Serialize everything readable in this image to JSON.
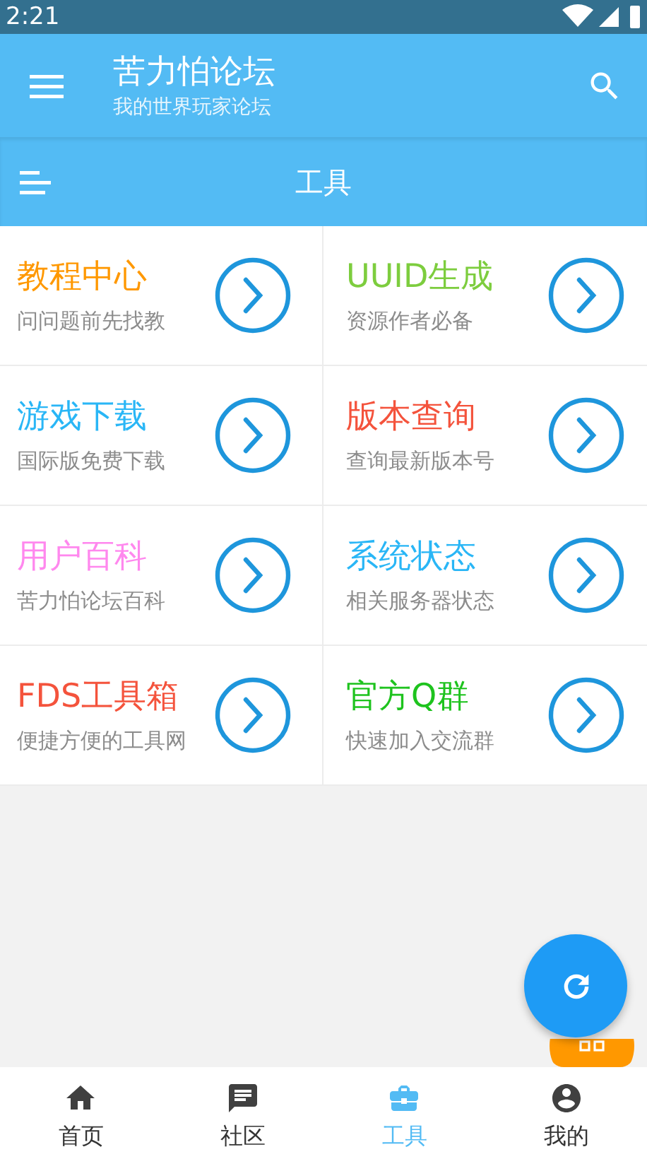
{
  "status_bar": {
    "time": "2:21"
  },
  "app_bar": {
    "title": "苦力怕论坛",
    "subtitle": "我的世界玩家论坛"
  },
  "toolbar": {
    "title": "工具"
  },
  "tools": [
    {
      "title": "教程中心",
      "subtitle": "问问题前先找教",
      "color": "#ff9800"
    },
    {
      "title": "UUID生成",
      "subtitle": "资源作者必备",
      "color": "#7dcd3e"
    },
    {
      "title": "游戏下载",
      "subtitle": "国际版免费下载",
      "color": "#29b6f6"
    },
    {
      "title": "版本查询",
      "subtitle": "查询最新版本号",
      "color": "#f4533c"
    },
    {
      "title": "用户百科",
      "subtitle": "苦力怕论坛百科",
      "color": "#ff88ee"
    },
    {
      "title": "系统状态",
      "subtitle": "相关服务器状态",
      "color": "#29b6f6"
    },
    {
      "title": "FDS工具箱",
      "subtitle": "便捷方便的工具网",
      "color": "#f4533c"
    },
    {
      "title": "官方Q群",
      "subtitle": "快速加入交流群",
      "color": "#1ec31e"
    }
  ],
  "bottom_nav": [
    {
      "label": "首页",
      "kind": "home",
      "selected": false
    },
    {
      "label": "社区",
      "kind": "chat",
      "selected": false
    },
    {
      "label": "工具",
      "kind": "toolbox",
      "selected": true
    },
    {
      "label": "我的",
      "kind": "account",
      "selected": false
    }
  ]
}
